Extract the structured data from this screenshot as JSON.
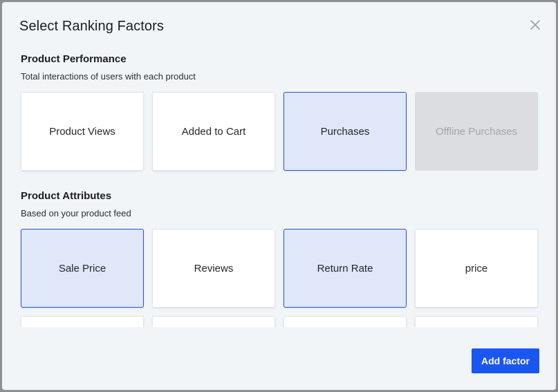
{
  "dialog": {
    "title": "Select Ranking Factors",
    "close_icon": "close-icon",
    "add_button_label": "Add factor",
    "accent_color": "#1a56f0",
    "selected_border_color": "#2a52d9",
    "selected_fill_color": "#dfe7f8"
  },
  "sections": [
    {
      "title": "Product Performance",
      "subtitle": "Total interactions of users with each product",
      "cards": [
        {
          "label": "Product Views",
          "state": "default"
        },
        {
          "label": "Added to Cart",
          "state": "default"
        },
        {
          "label": "Purchases",
          "state": "selected"
        },
        {
          "label": "Offline Purchases",
          "state": "disabled"
        }
      ]
    },
    {
      "title": "Product Attributes",
      "subtitle": "Based on your product feed",
      "cards": [
        {
          "label": "Sale Price",
          "state": "selected"
        },
        {
          "label": "Reviews",
          "state": "default"
        },
        {
          "label": "Return Rate",
          "state": "selected"
        },
        {
          "label": "price",
          "state": "default"
        },
        {
          "label": "",
          "state": "default"
        },
        {
          "label": "",
          "state": "default"
        },
        {
          "label": "",
          "state": "default"
        },
        {
          "label": "",
          "state": "default"
        }
      ]
    }
  ]
}
